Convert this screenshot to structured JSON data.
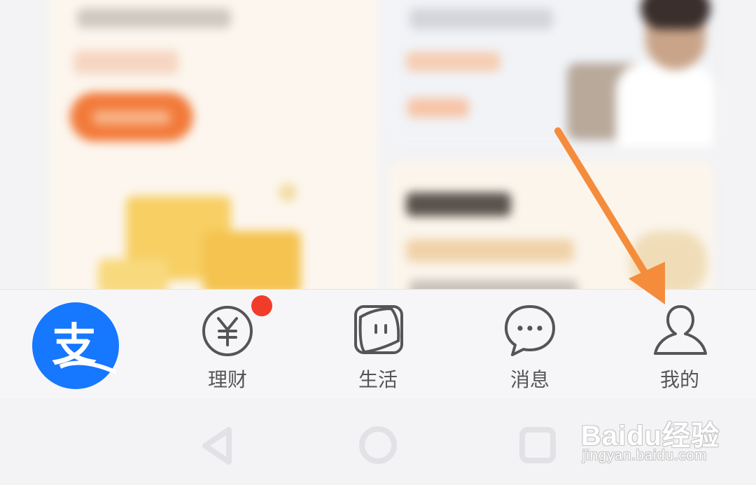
{
  "tabbar": {
    "home": {
      "icon": "alipay-logo-icon",
      "label": "支"
    },
    "tabs": [
      {
        "icon": "yuan-coin-icon",
        "label": "理财",
        "has_badge": true
      },
      {
        "icon": "life-square-icon",
        "label": "生活"
      },
      {
        "icon": "chat-bubble-icon",
        "label": "消息"
      },
      {
        "icon": "person-icon",
        "label": "我的"
      }
    ]
  },
  "system_nav": {
    "buttons": [
      "back-triangle-icon",
      "home-circle-icon",
      "recents-square-icon"
    ]
  },
  "annotation": {
    "type": "arrow",
    "color": "#f58c3c",
    "points_to": "我的"
  },
  "watermark": {
    "brand": "Baidu经验",
    "url": "jingyan.baidu.com"
  },
  "colors": {
    "brand_blue": "#1677ff",
    "badge_red": "#f23c2a",
    "icon_gray": "#555555",
    "arrow_orange": "#f58c3c"
  }
}
